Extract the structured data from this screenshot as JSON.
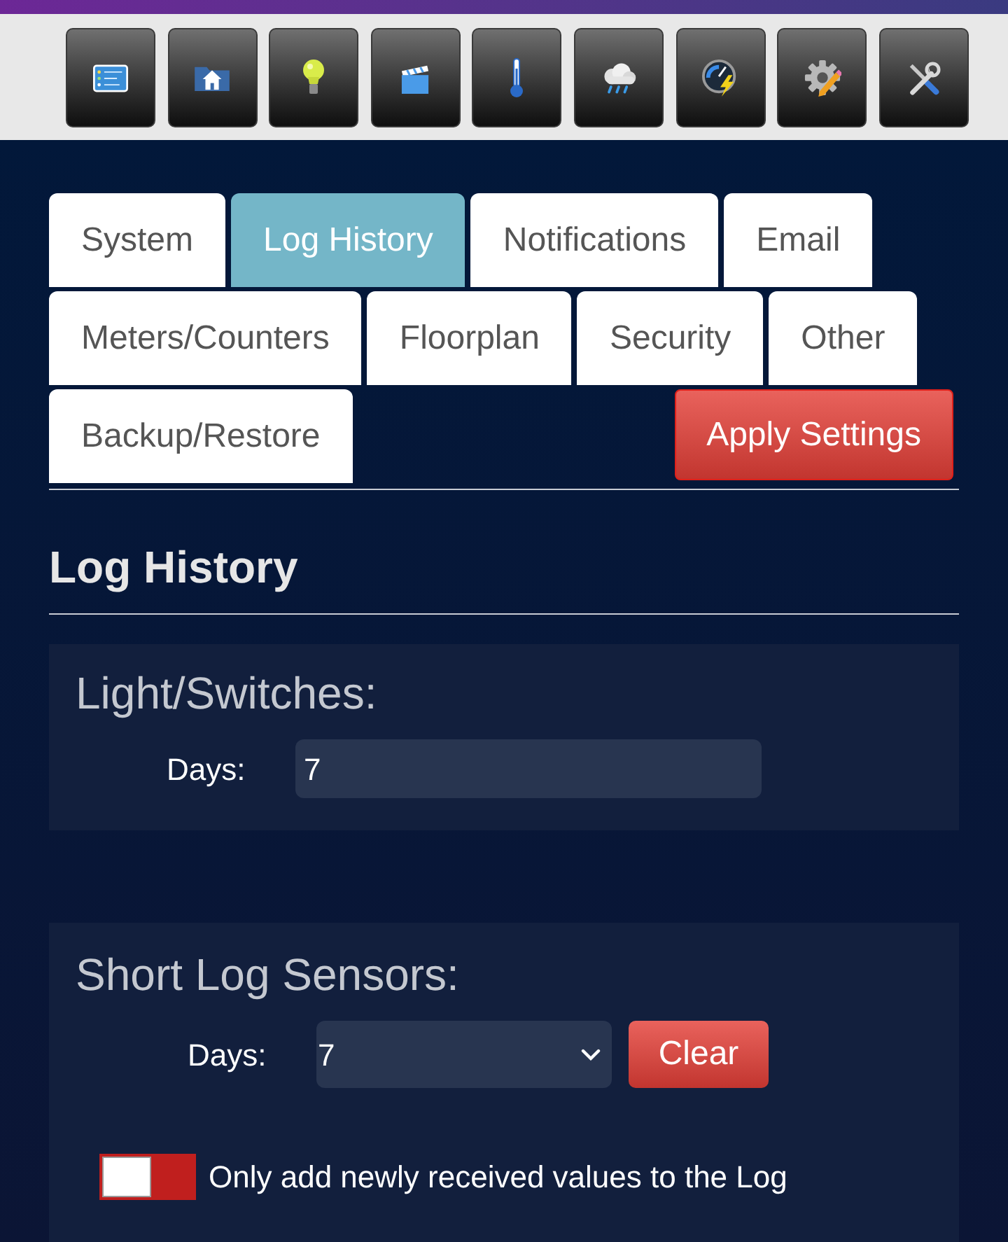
{
  "tabs": [
    {
      "label": "System",
      "selected": false
    },
    {
      "label": "Log History",
      "selected": true
    },
    {
      "label": "Notifications",
      "selected": false
    },
    {
      "label": "Email",
      "selected": false
    },
    {
      "label": "Meters/Counters",
      "selected": false
    },
    {
      "label": "Floorplan",
      "selected": false
    },
    {
      "label": "Security",
      "selected": false
    },
    {
      "label": "Other",
      "selected": false
    },
    {
      "label": "Backup/Restore",
      "selected": false
    }
  ],
  "apply_button": {
    "label": "Apply Settings"
  },
  "section": {
    "title": "Log History"
  },
  "panels": [
    {
      "title": "Light/Switches:",
      "fields": [
        {
          "kind": "input",
          "label": "Days:",
          "value": "7"
        }
      ]
    },
    {
      "title": "Short Log Sensors:",
      "fields": [
        {
          "kind": "select",
          "label": "Days:",
          "value": "7",
          "button": "Clear"
        }
      ],
      "toggle": {
        "label": "Only add newly received values to the Log",
        "on": false
      }
    }
  ]
}
